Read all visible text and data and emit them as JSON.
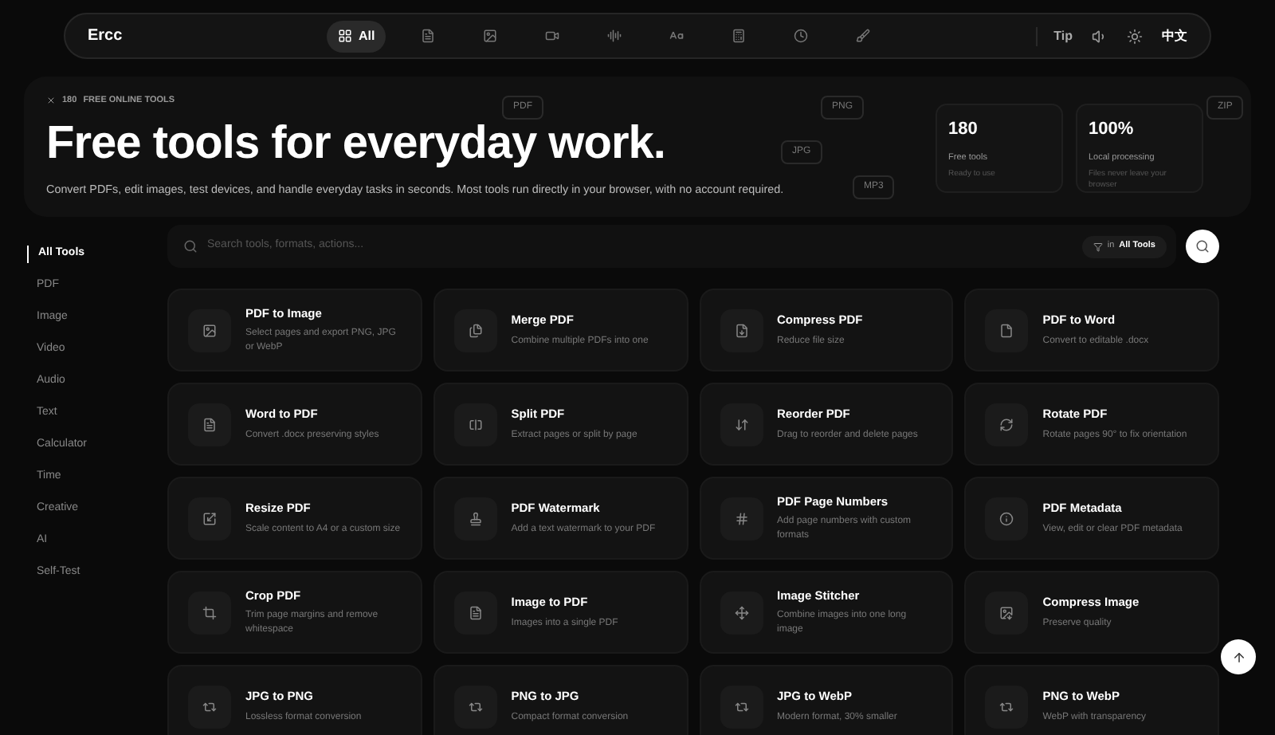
{
  "nav": {
    "logo": "Ercc",
    "items": [
      {
        "kind": "grid",
        "label": "All",
        "selected": true
      },
      {
        "kind": "pdf",
        "selected": false
      },
      {
        "kind": "image",
        "selected": false
      },
      {
        "kind": "video",
        "selected": false
      },
      {
        "kind": "audio",
        "selected": false
      },
      {
        "kind": "text",
        "selected": false
      },
      {
        "kind": "calculator",
        "selected": false
      },
      {
        "kind": "clock",
        "selected": false
      },
      {
        "kind": "brush",
        "selected": false
      }
    ],
    "tip": "Tip",
    "language": "中文"
  },
  "hero": {
    "badge_count": "180",
    "badge_label": "FREE ONLINE TOOLS",
    "title": "Free tools for everyday work.",
    "subtitle": "Convert PDFs, edit images, test devices, and handle everyday tasks in seconds. Most tools run directly in your browser, with no account required.",
    "floating_tags": [
      "PDF",
      "PNG",
      "JPG",
      "MP3",
      "ZIP"
    ],
    "stats": [
      {
        "value": "180",
        "label": "Free tools",
        "note": "Ready to use"
      },
      {
        "value": "100%",
        "label": "Local processing",
        "note": "Files never leave your browser"
      }
    ]
  },
  "sidebar": {
    "items": [
      {
        "label": "All Tools",
        "selected": true
      },
      {
        "label": "PDF",
        "selected": false
      },
      {
        "label": "Image",
        "selected": false
      },
      {
        "label": "Video",
        "selected": false
      },
      {
        "label": "Audio",
        "selected": false
      },
      {
        "label": "Text",
        "selected": false
      },
      {
        "label": "Calculator",
        "selected": false
      },
      {
        "label": "Time",
        "selected": false
      },
      {
        "label": "Creative",
        "selected": false
      },
      {
        "label": "AI",
        "selected": false
      },
      {
        "label": "Self-Test",
        "selected": false
      }
    ]
  },
  "search": {
    "placeholder": "Search tools, formats, actions...",
    "scope_prefix": "in",
    "scope": "All Tools"
  },
  "tools": [
    {
      "kind": "image",
      "title": "PDF to Image",
      "description": "Select pages and export PNG, JPG or WebP"
    },
    {
      "kind": "files",
      "title": "Merge PDF",
      "description": "Combine multiple PDFs into one"
    },
    {
      "kind": "compress",
      "title": "Compress PDF",
      "description": "Reduce file size"
    },
    {
      "kind": "doc",
      "title": "PDF to Word",
      "description": "Convert to editable .docx"
    },
    {
      "kind": "pdf",
      "title": "Word to PDF",
      "description": "Convert .docx preserving styles"
    },
    {
      "kind": "split",
      "title": "Split PDF",
      "description": "Extract pages or split by page"
    },
    {
      "kind": "reorder",
      "title": "Reorder PDF",
      "description": "Drag to reorder and delete pages"
    },
    {
      "kind": "rotate",
      "title": "Rotate PDF",
      "description": "Rotate pages 90° to fix orientation"
    },
    {
      "kind": "resize",
      "title": "Resize PDF",
      "description": "Scale content to A4 or a custom size"
    },
    {
      "kind": "stamp",
      "title": "PDF Watermark",
      "description": "Add a text watermark to your PDF"
    },
    {
      "kind": "hash",
      "title": "PDF Page Numbers",
      "description": "Add page numbers with custom formats"
    },
    {
      "kind": "info",
      "title": "PDF Metadata",
      "description": "View, edit or clear PDF metadata"
    },
    {
      "kind": "crop",
      "title": "Crop PDF",
      "description": "Trim page margins and remove whitespace"
    },
    {
      "kind": "pdf",
      "title": "Image to PDF",
      "description": "Images into a single PDF"
    },
    {
      "kind": "move",
      "title": "Image Stitcher",
      "description": "Combine images into one long image"
    },
    {
      "kind": "image-compress",
      "title": "Compress Image",
      "description": "Preserve quality"
    },
    {
      "kind": "convert",
      "title": "JPG to PNG",
      "description": "Lossless format conversion"
    },
    {
      "kind": "convert",
      "title": "PNG to JPG",
      "description": "Compact format conversion"
    },
    {
      "kind": "convert",
      "title": "JPG to WebP",
      "description": "Modern format, 30% smaller"
    },
    {
      "kind": "convert",
      "title": "PNG to WebP",
      "description": "WebP with transparency"
    }
  ]
}
